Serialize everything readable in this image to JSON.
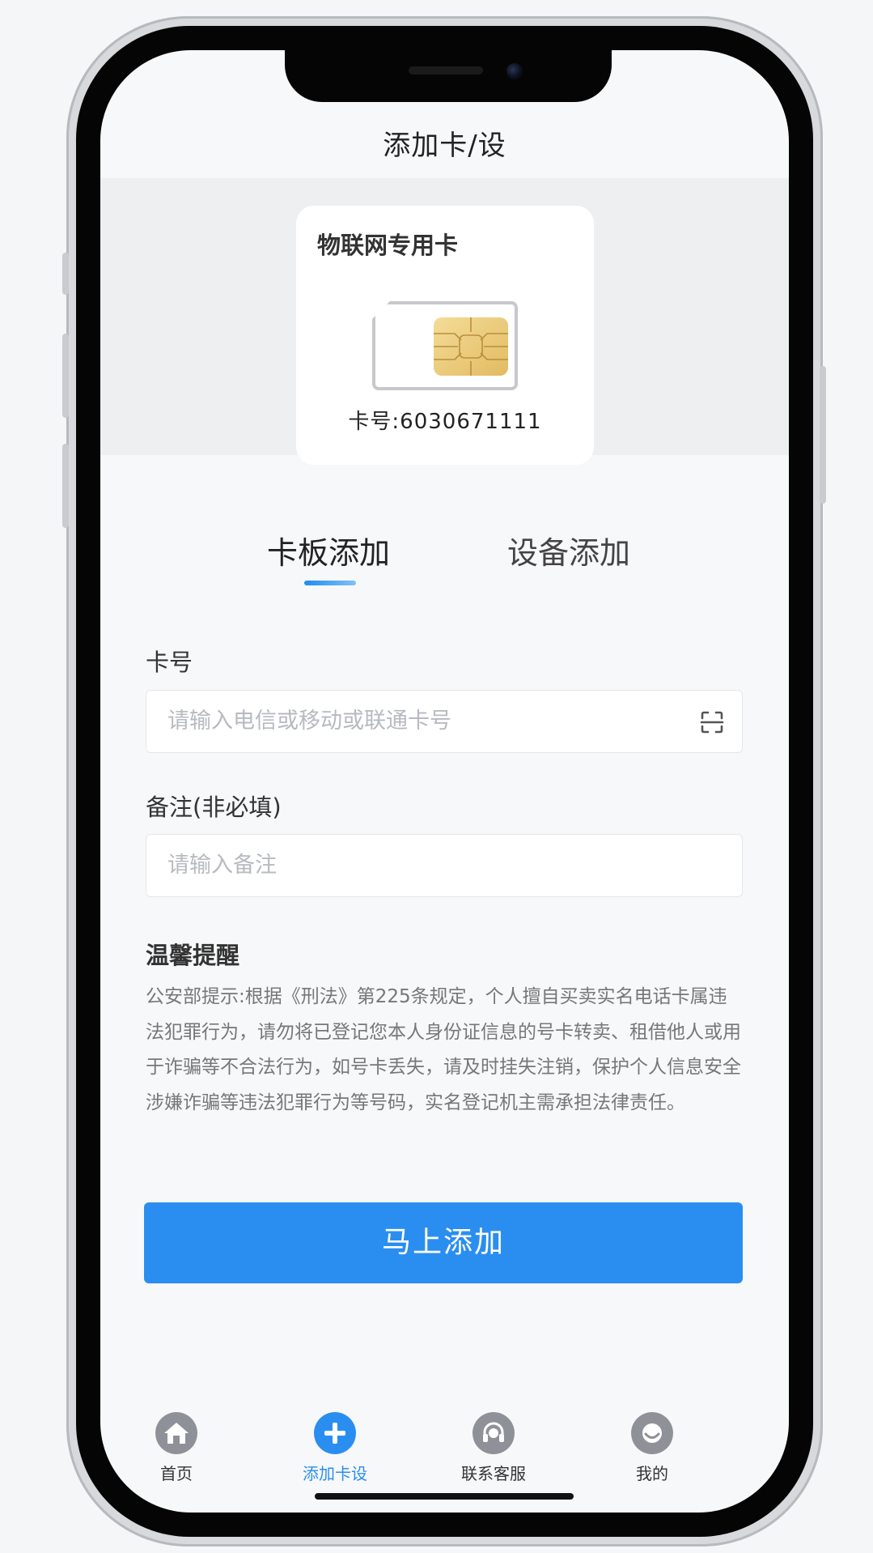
{
  "header": {
    "title": "添加卡/设"
  },
  "sim_card": {
    "title": "物联网专用卡",
    "number_text": "卡号:6030671111"
  },
  "tabs": [
    {
      "label": "卡板添加",
      "active": true
    },
    {
      "label": "设备添加",
      "active": false
    }
  ],
  "form": {
    "card_number": {
      "label": "卡号",
      "value": "",
      "placeholder": "请输入电信或移动或联通卡号"
    },
    "remark": {
      "label": "备注(非必填)",
      "value": "",
      "placeholder": "请输入备注"
    }
  },
  "tips": {
    "title": "温馨提醒",
    "body": "公安部提示:根据《刑法》第225条规定，个人擅自买卖实名电话卡属违法犯罪行为，请勿将已登记您本人身份证信息的号卡转卖、租借他人或用于诈骗等不合法行为，如号卡丢失，请及时挂失注销，保护个人信息安全涉嫌诈骗等违法犯罪行为等号码，实名登记机主需承担法律责任。"
  },
  "submit_label": "马上添加",
  "tabbar": [
    {
      "label": "首页",
      "icon": "home-icon",
      "active": false
    },
    {
      "label": "添加卡设",
      "icon": "plus-icon",
      "active": true
    },
    {
      "label": "联系客服",
      "icon": "headset-icon",
      "active": false
    },
    {
      "label": "我的",
      "icon": "profile-icon",
      "active": false
    }
  ],
  "colors": {
    "accent": "#2a8ef0",
    "inactive_icon": "#8e9298",
    "background": "#f7f8fa"
  }
}
